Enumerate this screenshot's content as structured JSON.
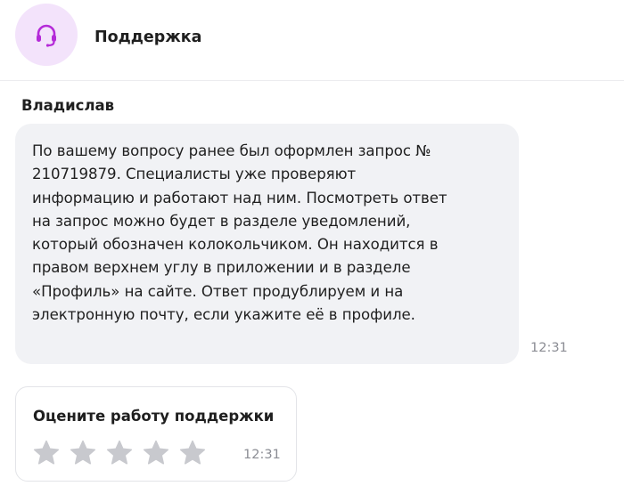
{
  "header": {
    "title": "Поддержка",
    "avatar_icon": "headset-icon",
    "avatar_color": "#f3e3fb",
    "icon_color": "#b42ad8"
  },
  "message": {
    "sender": "Владислав",
    "lines": [
      "По вашему вопросу ранее был оформлен запрос №",
      "210719879. Специалисты уже проверяют",
      "информацию и работают над ним. Посмотреть ответ",
      "на запрос можно будет в разделе уведомлений,",
      "который обозначен колокольчиком. Он находится в",
      "правом верхнем углу в приложении и в разделе",
      "«Профиль» на сайте. Ответ продублируем и на",
      "электронную почту, если укажите её в профиле."
    ],
    "time": "12:31",
    "bubble_color": "#f1f2f5"
  },
  "rating": {
    "title": "Оцените работу поддержки",
    "stars_total": 5,
    "stars_selected": 0,
    "star_color": "#c8c9ce",
    "time": "12:31"
  }
}
